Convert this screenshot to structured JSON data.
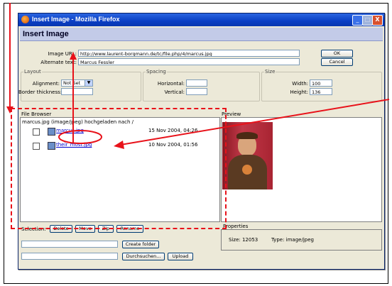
{
  "window": {
    "title": "Insert Image - Mozilla Firefox",
    "buttons": {
      "minimize": "_",
      "maximize": "□",
      "close": "X"
    }
  },
  "dialog": {
    "heading": "Insert Image",
    "image_url_label": "Image URL:",
    "image_url_value": "http://www.laurent-borgmann.de/tc/file.php/4/marcus.jpg",
    "alt_text_label": "Alternate text:",
    "alt_text_value": "Marcus Fessler",
    "ok_label": "OK",
    "cancel_label": "Cancel"
  },
  "layout_group": {
    "title": "Layout",
    "alignment_label": "Alignment:",
    "alignment_value": "Not Set",
    "border_label": "Border thickness:",
    "border_value": ""
  },
  "spacing_group": {
    "title": "Spacing",
    "horizontal_label": "Horizontal:",
    "horizontal_value": "",
    "vertical_label": "Vertical:",
    "vertical_value": ""
  },
  "size_group": {
    "title": "Size",
    "width_label": "Width:",
    "width_value": "100",
    "height_label": "Height:",
    "height_value": "136"
  },
  "file_browser": {
    "title": "File Browser",
    "status_message": "marcus.jpg (image/jpeg) hochgeladen nach /",
    "files": [
      {
        "name": "marcus.jpg",
        "date": "15 Nov 2004, 04:26"
      },
      {
        "name": "their_most.jpg",
        "date": "10 Nov 2004, 01:56"
      }
    ],
    "selection_label": "Selection:",
    "actions": [
      "Delete",
      "Move",
      "Zip",
      "Rename"
    ]
  },
  "preview": {
    "title": "Preview",
    "properties_title": "Properties",
    "size_text": "Size: 12053",
    "type_text": "Type: image/jpeg"
  },
  "upload": {
    "create_folder_label": "Create folder",
    "browse_label": "Durchsuchen...",
    "upload_label": "Upload"
  },
  "colors": {
    "annotation": "#e8121a",
    "titlebar": "#0a3fc4",
    "dialog_bg": "#ece9d8"
  }
}
